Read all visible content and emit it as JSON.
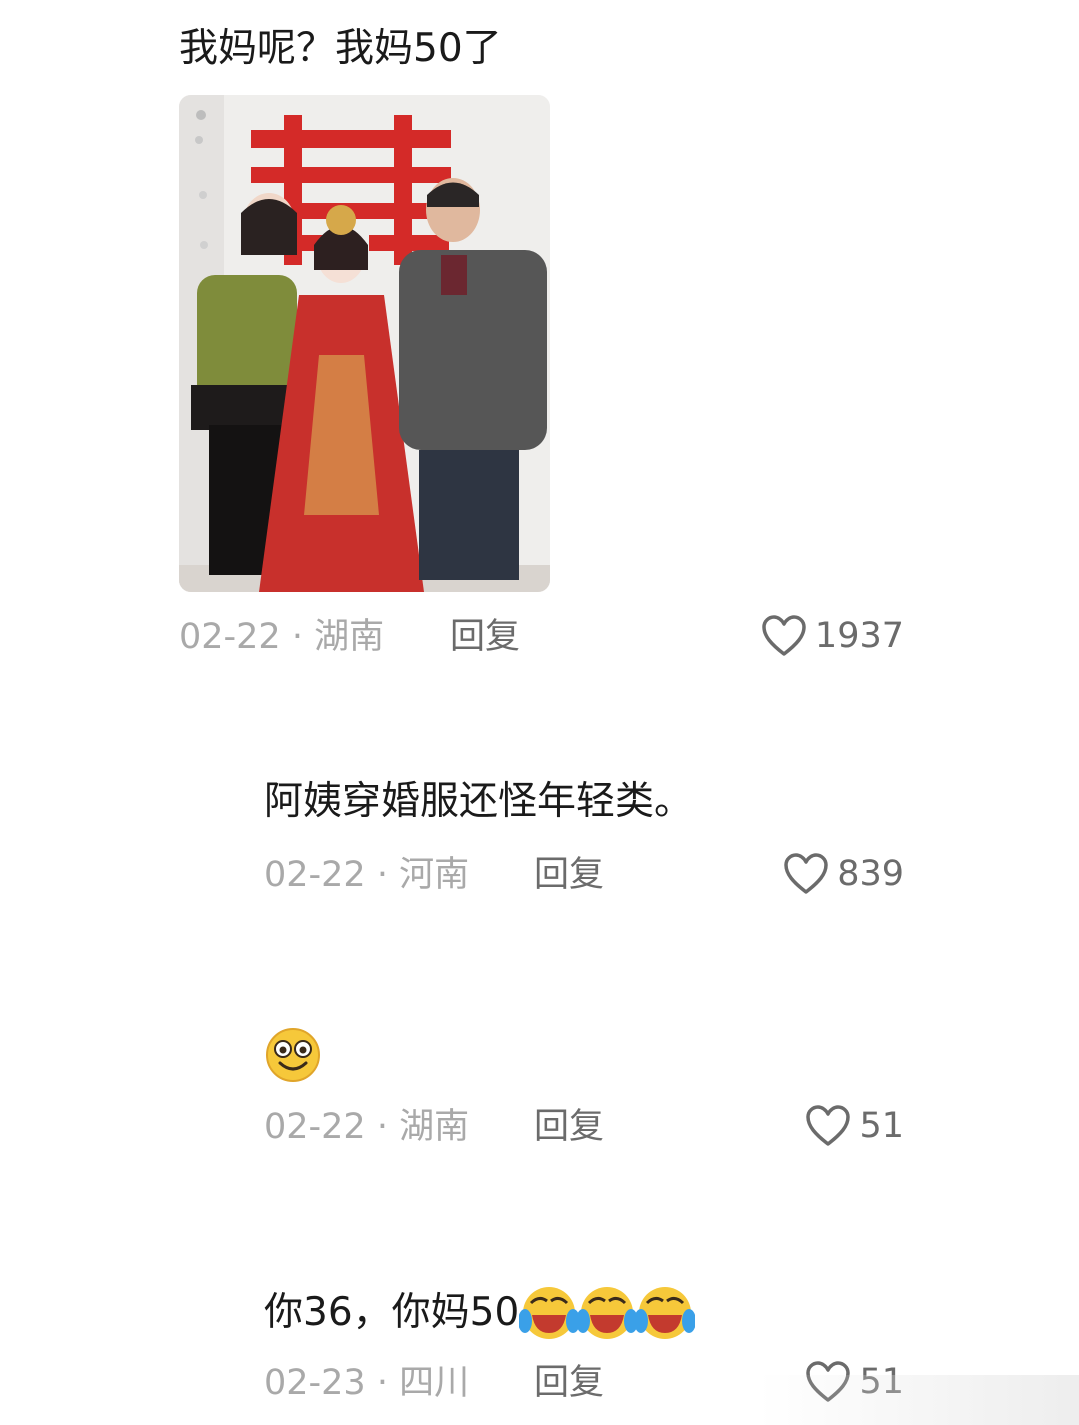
{
  "comments": [
    {
      "text": "我妈呢？我妈50了",
      "date": "02-22",
      "location": "湖南",
      "reply": "回复",
      "likes": "1937"
    },
    {
      "text": "阿姨穿婚服还怪年轻类。",
      "date": "02-22",
      "location": "河南",
      "reply": "回复",
      "likes": "839"
    },
    {
      "text": "",
      "date": "02-22",
      "location": "湖南",
      "reply": "回复",
      "likes": "51",
      "emoji": "smile-emoji"
    },
    {
      "text": "你36，你妈50",
      "date": "02-23",
      "location": "四川",
      "reply": "回复",
      "likes": "51",
      "emoji": "laugh-cry-emoji"
    }
  ],
  "photo": {
    "wedding_symbol": "囍"
  },
  "icons": {
    "like": "heart-outline-icon"
  },
  "colors": {
    "meta": "#a9a9a9",
    "action": "#6b6b6b",
    "text": "#1a1a1a"
  }
}
